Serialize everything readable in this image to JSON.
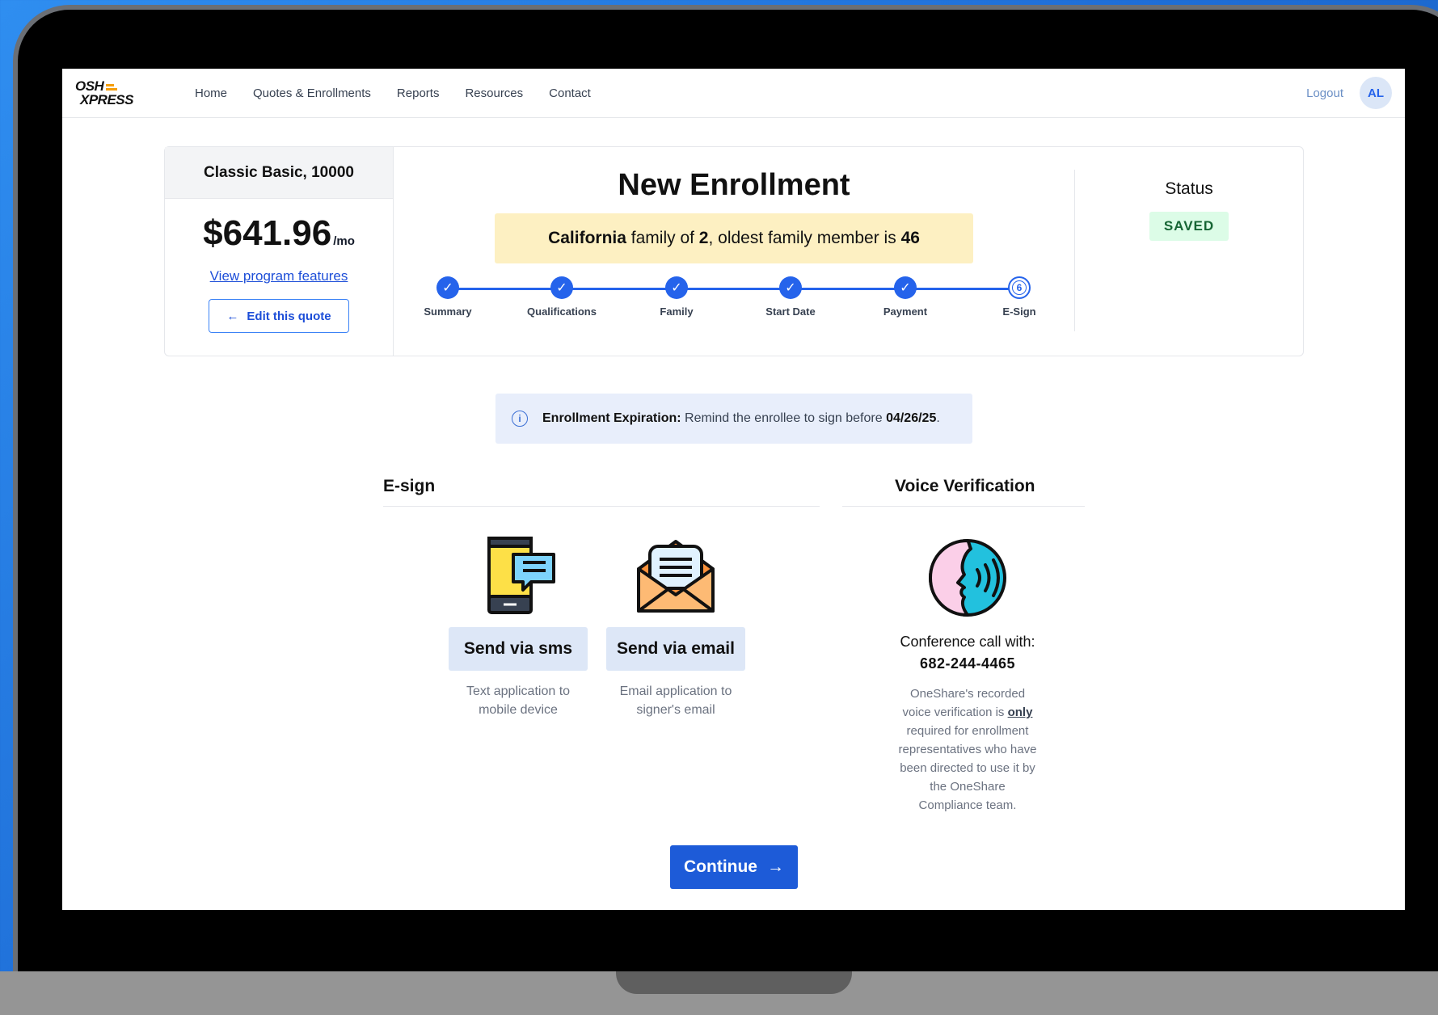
{
  "nav": {
    "logo_top": "OSH",
    "logo_bottom": "XPRESS",
    "links": [
      "Home",
      "Quotes & Enrollments",
      "Reports",
      "Resources",
      "Contact"
    ],
    "logout": "Logout",
    "avatar": "AL"
  },
  "quote": {
    "plan": "Classic Basic, 10000",
    "price": "$641.96",
    "per": "/mo",
    "features_link": "View program features",
    "edit_label": "Edit this quote"
  },
  "enrollment": {
    "title": "New Enrollment",
    "banner_state": "California",
    "banner_mid": " family of ",
    "banner_size": "2",
    "banner_end": ", oldest family member is ",
    "banner_age": "46",
    "steps": [
      {
        "label": "Summary",
        "done": true
      },
      {
        "label": "Qualifications",
        "done": true
      },
      {
        "label": "Family",
        "done": true
      },
      {
        "label": "Start Date",
        "done": true
      },
      {
        "label": "Payment",
        "done": true
      },
      {
        "label": "E-Sign",
        "done": false,
        "number": "6"
      }
    ]
  },
  "status": {
    "label": "Status",
    "value": "SAVED"
  },
  "expiration": {
    "bold_label": "Enrollment Expiration:",
    "text": " Remind the enrollee to sign before ",
    "date": "04/26/25",
    "end": "."
  },
  "esign": {
    "title": "E-sign",
    "sms_button": "Send via sms",
    "sms_desc_1": "Text application to",
    "sms_desc_2": "mobile device",
    "email_button": "Send via email",
    "email_desc_1": "Email application to",
    "email_desc_2": "signer's email"
  },
  "voice": {
    "title": "Voice Verification",
    "conf_label": "Conference call with:",
    "phone": "682-244-4465",
    "note_a": "OneShare's recorded voice verification is ",
    "note_only": "only",
    "note_b": " required for enrollment representatives who have been directed to use it by the OneShare Compliance team."
  },
  "continue_label": "Continue",
  "colors": {
    "primary": "#1d5bd8",
    "saved_bg": "#dcfce7",
    "banner_bg": "#fdf0c2",
    "background": "#1f6fd8"
  }
}
